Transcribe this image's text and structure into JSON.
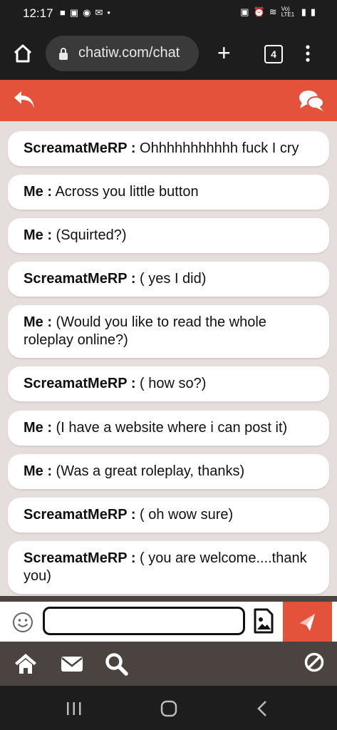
{
  "status": {
    "time": "12:17",
    "left_icons": [
      "chat-icon",
      "print-icon",
      "location-icon",
      "mail-icon",
      "dot-icon"
    ],
    "right_icons": [
      "alarm-lock-icon",
      "alarm-icon",
      "wifi-icon",
      "lte-icon",
      "signal-icon",
      "battery-icon"
    ],
    "lte_label": "Vo) LTE1"
  },
  "browser": {
    "url": "chatiw.com/chat",
    "tab_count": "4"
  },
  "messages": [
    {
      "sender": "ScreamatMeRP :",
      "text": " Ohhhhhhhhhhh fuck I cry"
    },
    {
      "sender": "Me :",
      "text": " Across you little button"
    },
    {
      "sender": "Me :",
      "text": " (Squirted?)"
    },
    {
      "sender": "ScreamatMeRP :",
      "text": " ( yes I did)"
    },
    {
      "sender": "Me :",
      "text": " (Would you like to read the whole roleplay online?)"
    },
    {
      "sender": "ScreamatMeRP :",
      "text": " ( how so?)"
    },
    {
      "sender": "Me :",
      "text": " (I have a website where i can post it)"
    },
    {
      "sender": "Me :",
      "text": " (Was a great roleplay, thanks)"
    },
    {
      "sender": "ScreamatMeRP :",
      "text": " ( oh wow sure)"
    },
    {
      "sender": "ScreamatMeRP :",
      "text": " ( you are welcome....thank you)"
    }
  ],
  "composer": {
    "value": "",
    "placeholder": ""
  },
  "colors": {
    "accent": "#e5523b",
    "chat_background": "#e6dedc",
    "nav_background": "#4a433f",
    "system_bar": "#1d1d1d"
  }
}
